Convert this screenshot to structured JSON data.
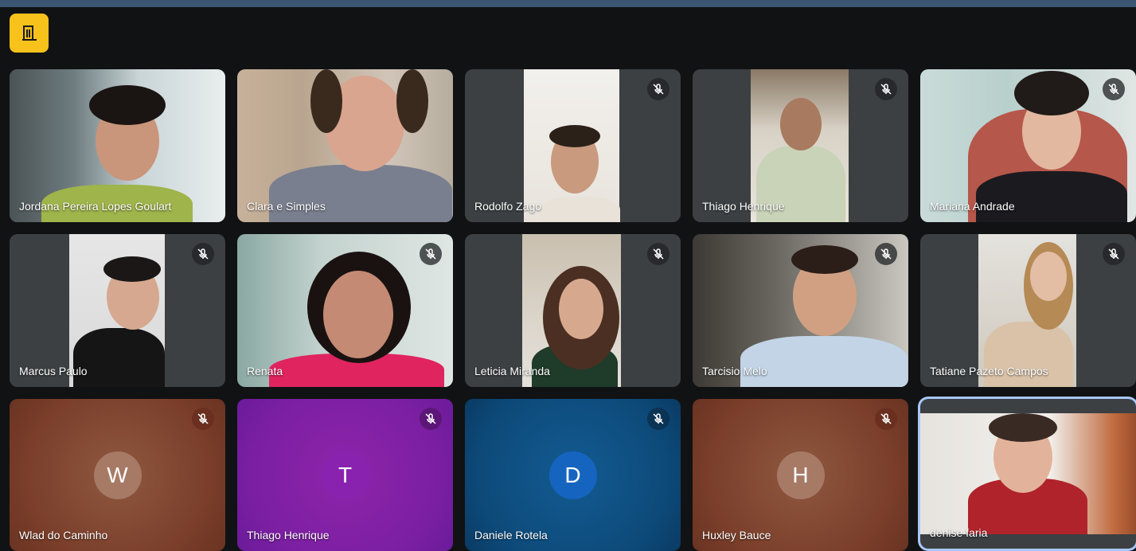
{
  "participants": [
    {
      "name": "Jordana Pereira Lopes Goulart"
    },
    {
      "name": "Clara e Simples"
    },
    {
      "name": "Rodolfo Zago"
    },
    {
      "name": "Thiago Henrique"
    },
    {
      "name": "Mariana Andrade"
    },
    {
      "name": "Marcus Paulo"
    },
    {
      "name": "Renata"
    },
    {
      "name": "Leticia Miranda"
    },
    {
      "name": "Tarcisio Melo"
    },
    {
      "name": "Tatiane Pazeto Campos"
    },
    {
      "name": "Wlad do Caminho",
      "initial": "W"
    },
    {
      "name": "Thiago Henrique",
      "initial": "T"
    },
    {
      "name": "Daniele Rotela",
      "initial": "D"
    },
    {
      "name": "Huxley Bauce",
      "initial": "H"
    },
    {
      "name": "denise faria"
    }
  ],
  "colors": {
    "accent": "#f6c21b",
    "tile_bg": "#3c4043",
    "brown_tile": "#8b4a34",
    "purple_tile": "#8e24aa",
    "blue_tile": "#0d4a7a",
    "self_outline": "#a8c7fa"
  },
  "icons": {
    "app": "door-icon",
    "muted": "mic-off-icon"
  }
}
